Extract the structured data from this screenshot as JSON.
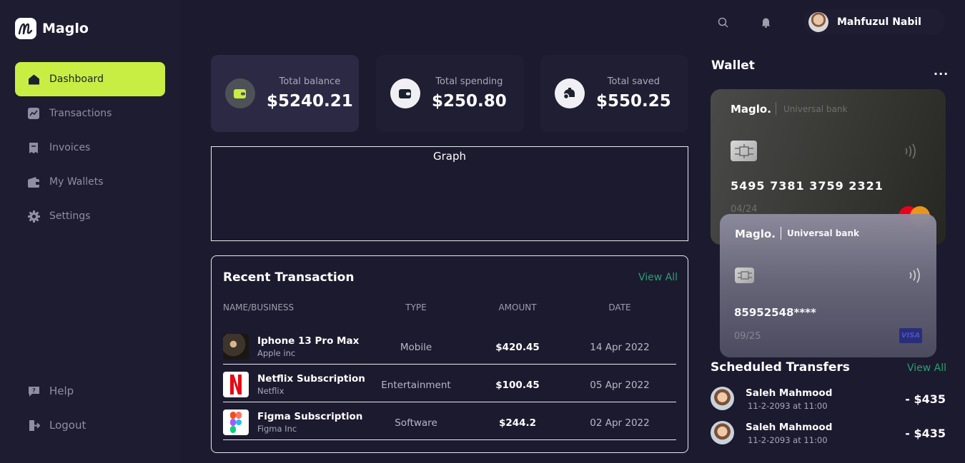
{
  "app": {
    "name": "Maglo"
  },
  "sidebar": {
    "items": [
      {
        "label": "Dashboard",
        "icon": "home-icon",
        "active": true
      },
      {
        "label": "Transactions",
        "icon": "chart-icon",
        "active": false
      },
      {
        "label": "Invoices",
        "icon": "invoice-icon",
        "active": false
      },
      {
        "label": "My Wallets",
        "icon": "wallet-icon",
        "active": false
      },
      {
        "label": "Settings",
        "icon": "gear-icon",
        "active": false
      }
    ],
    "bottom": [
      {
        "label": "Help",
        "icon": "help-icon"
      },
      {
        "label": "Logout",
        "icon": "logout-icon"
      }
    ]
  },
  "header": {
    "user_name": "Mahfuzul Nabil",
    "icons": [
      "search-icon",
      "bell-icon"
    ]
  },
  "stats": [
    {
      "label": "Total balance",
      "value": "$5240.21",
      "icon": "wallet-icon"
    },
    {
      "label": "Total spending",
      "value": "$250.80",
      "icon": "wallet-icon"
    },
    {
      "label": "Total saved",
      "value": "$550.25",
      "icon": "savings-icon"
    }
  ],
  "graph": {
    "title": "Graph"
  },
  "recent": {
    "title": "Recent Transaction",
    "view_all": "View All",
    "columns": [
      "NAME/BUSINESS",
      "TYPE",
      "AMOUNT",
      "DATE"
    ],
    "rows": [
      {
        "name": "Iphone 13 Pro Max",
        "business": "Apple inc",
        "type": "Mobile",
        "amount": "$420.45",
        "date": "14 Apr 2022",
        "thumb": "iphone-thumbnail"
      },
      {
        "name": "Netflix Subscription",
        "business": "Netflix",
        "type": "Entertainment",
        "amount": "$100.45",
        "date": "05 Apr 2022",
        "thumb": "netflix-logo"
      },
      {
        "name": "Figma Subscription",
        "business": "Figma Inc",
        "type": "Software",
        "amount": "$244.2",
        "date": "02 Apr 2022",
        "thumb": "figma-logo"
      }
    ]
  },
  "wallet": {
    "title": "Wallet",
    "more": "...",
    "cards": [
      {
        "brand": "Maglo.",
        "bank": "Universal bank",
        "number": "5495  7381  3759  2321",
        "expiry": "04/24",
        "network": "mastercard-logo"
      },
      {
        "brand": "Maglo.",
        "bank": "Universal bank",
        "number": "85952548****",
        "expiry": "09/25",
        "network_label": "VISA"
      }
    ]
  },
  "scheduled": {
    "title": "Scheduled Transfers",
    "view_all": "View All",
    "items": [
      {
        "name": "Saleh Mahmood",
        "date": "11-2-2093 at 11:00",
        "amount": "- $435"
      },
      {
        "name": "Saleh Mahmood",
        "date": "11-2-2093 at 11:00",
        "amount": "- $435"
      }
    ]
  },
  "colors": {
    "accent": "#c8ee44",
    "background": "#1c1a2e",
    "link": "#29a073"
  }
}
